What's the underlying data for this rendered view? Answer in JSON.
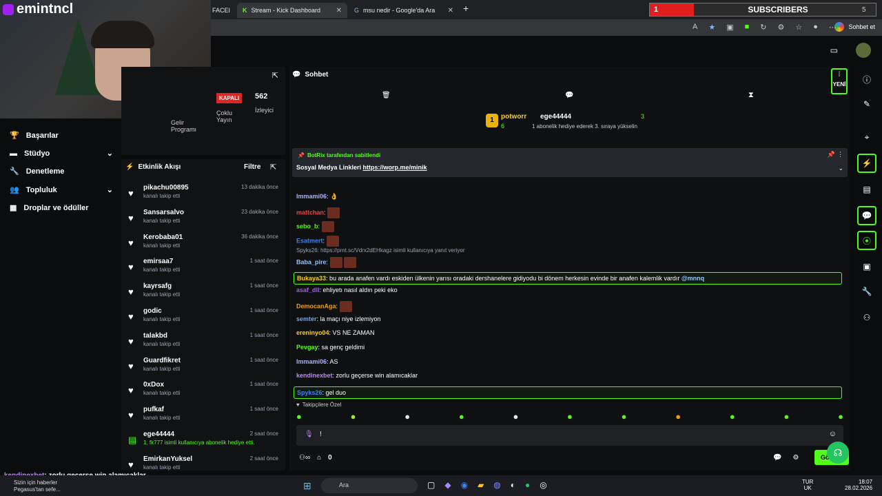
{
  "overlay": {
    "channel": "emintncl",
    "chat_line_user": "kendinexbet",
    "chat_line_text": ": zorlu geçerse win alamıcaklar",
    "sub_count": "1",
    "sub_label": "SUBSCRIBERS",
    "sub_goal": "5"
  },
  "tabs": [
    {
      "label": "FACEI"
    },
    {
      "label": "Stream - Kick Dashboard"
    },
    {
      "label": "msu nedir - Google'da Ara"
    }
  ],
  "browser": {
    "chat_btn": "Sohbet et"
  },
  "stats": {
    "status": "KAPALI",
    "viewers": "562",
    "viewers_label": "İzleyici",
    "multi": "Çoklu Yayın",
    "partner": "Gelir Programı"
  },
  "nav": [
    {
      "label": "Başarılar"
    },
    {
      "label": "Stüdyo"
    },
    {
      "label": "Denetleme"
    },
    {
      "label": "Topluluk"
    },
    {
      "label": "Droplar ve ödüller"
    }
  ],
  "activity": {
    "title": "Etkinlik Akışı",
    "filter": "Filtre",
    "items": [
      {
        "name": "pikachu00895",
        "sub": "kanalı takip etti",
        "time": "13 dakika önce"
      },
      {
        "name": "Sansarsalvo",
        "sub": "kanalı takip etti",
        "time": "23 dakika önce"
      },
      {
        "name": "Kerobaba01",
        "sub": "kanalı takip etti",
        "time": "36 dakika önce"
      },
      {
        "name": "emirsaa7",
        "sub": "kanalı takip etti",
        "time": "1 saat önce"
      },
      {
        "name": "kayrsafg",
        "sub": "kanalı takip etti",
        "time": "1 saat önce"
      },
      {
        "name": "godic",
        "sub": "kanalı takip etti",
        "time": "1 saat önce"
      },
      {
        "name": "talakbd",
        "sub": "kanalı takip etti",
        "time": "1 saat önce"
      },
      {
        "name": "Guardfikret",
        "sub": "kanalı takip etti",
        "time": "1 saat önce"
      },
      {
        "name": "0xDox",
        "sub": "kanalı takip etti",
        "time": "1 saat önce"
      },
      {
        "name": "pufkaf",
        "sub": "kanalı takip etti",
        "time": "1 saat önce"
      },
      {
        "name": "ege44444",
        "sub": "1, fk777 isimli kullanıcıya abonelik hediye etti.",
        "time": "2 saat önce"
      },
      {
        "name": "EmirkanYuksel",
        "sub": "kanalı takip etti",
        "time": "2 saat önce"
      }
    ]
  },
  "chat": {
    "title": "Sohbet",
    "new_badge": "YENİ",
    "top1": {
      "rank": "1",
      "name": "potworr",
      "count": "6"
    },
    "top2": {
      "name": "ege44444",
      "count": "3",
      "note": "1 abonelik hediye ederek 3. sıraya yükselin"
    },
    "pinned_by": "BotRix tarafından sabitlendi",
    "pinned_text": "Sosyal Medya Linkleri ",
    "pinned_link": "https://worp.me/minik",
    "reply_note": "Spyks26: https://prnt.sc/Vdrx2dEHkagz isimli kullanıcıya yanıt veriyor",
    "messages": [
      {
        "user": "Immami06",
        "text": ": 👌",
        "color": "#a5b4fc"
      },
      {
        "user": "mattchan",
        "text": ":",
        "color": "#ef4444"
      },
      {
        "user": "sebo_b",
        "text": ":",
        "color": "#53fc18"
      },
      {
        "user": "Esatmert",
        "text": ":",
        "color": "#3b82f6"
      },
      {
        "user": "Baba_pire",
        "text": ":",
        "color": "#93c5fd"
      },
      {
        "user": "Bukaya33",
        "text": ": bu arada anafen vardı eskiden ülkenin yarısı oradaki dershanelere gidiyodu bi dönem herkesin evinde bir anafen kalemlik vardır ",
        "mention": "@mnnq",
        "color": "#facc15"
      },
      {
        "user": "asaf_dll",
        "text": ": ehliyetı nasıl aldın peki eko",
        "color": "#a855f7"
      },
      {
        "user": "DemocanAga",
        "text": ":",
        "color": "#f59e0b"
      },
      {
        "user": "semter",
        "text": ": la maçı niye izlemiyon",
        "color": "#60a5fa"
      },
      {
        "user": "ereninyo04",
        "text": ": VS NE ZAMAN",
        "color": "#facc15"
      },
      {
        "user": "Pevgay",
        "text": ": sa genç geldimi",
        "color": "#53fc18"
      },
      {
        "user": "Immami06",
        "text": ": AS",
        "color": "#a5b4fc"
      },
      {
        "user": "kendinexbet",
        "text": ": zorlu geçerse win alamıcaklar",
        "color": "#c084fc"
      },
      {
        "user": "Spyks26",
        "text": ": gel duo",
        "color": "#3b82f6"
      }
    ],
    "followers_only": "Takipçilere Özel",
    "input_value": "!",
    "send": "Gönder",
    "count": "0"
  },
  "taskbar": {
    "search": "Ara",
    "lang1": "TUR",
    "lang2": "UK",
    "time": "18:07",
    "date": "28.02.2026",
    "news1": "Sizin için haberler",
    "news2": "Pegasus'tan sefe..."
  }
}
